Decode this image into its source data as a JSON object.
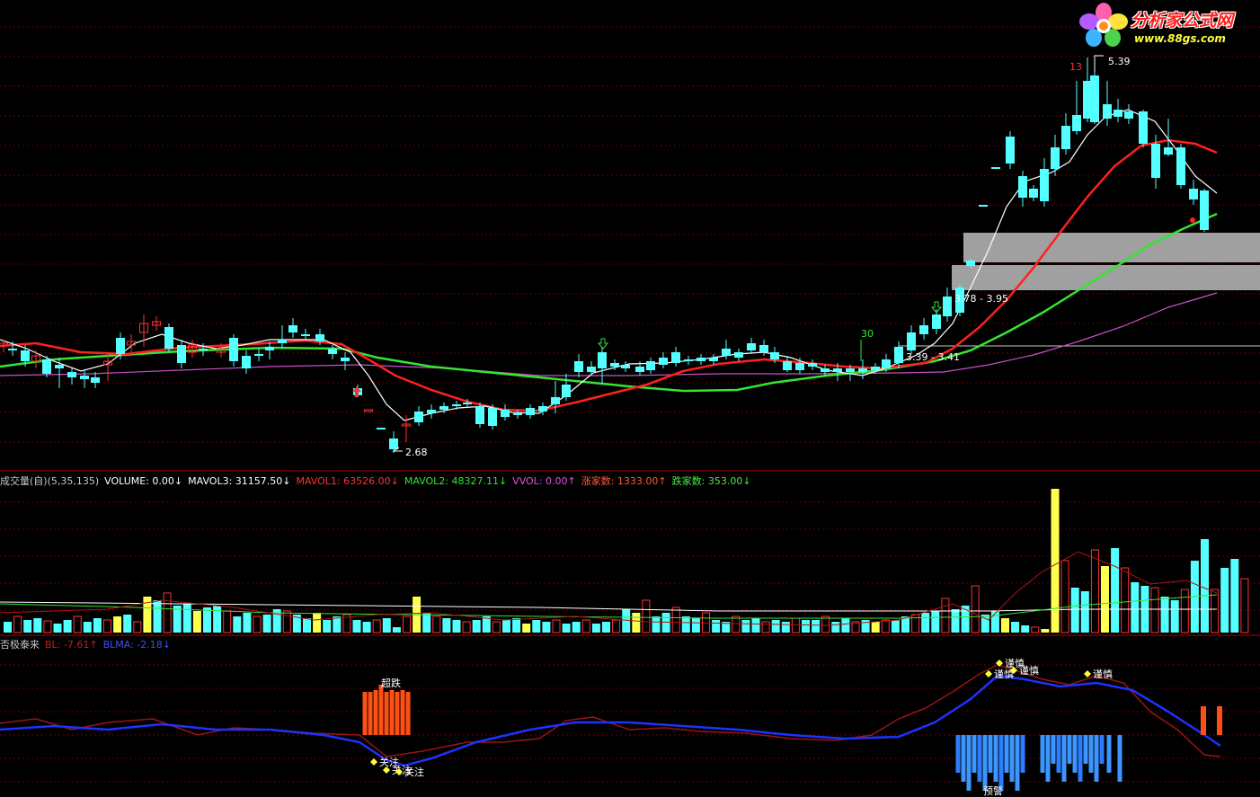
{
  "logo": {
    "title": "分析家公式网",
    "url_text": "www.88gs.com",
    "icon": "flower-logo-icon"
  },
  "colors": {
    "background": "#000000",
    "grid": "#6e0000",
    "panel_border": "#b40000",
    "candle_up": "#ff3232",
    "candle_down": "#54ffff",
    "ma_white": "#ffffff",
    "ma_red": "#ff2020",
    "ma_green": "#32e632",
    "ma_purple": "#c850c8",
    "volume_highlight": "#ffff50",
    "indicator_dark": "#9b1414",
    "indicator_blue": "#1e32ff",
    "alert_orange": "#ff5014",
    "alert_blue": "#3c96ff",
    "label_yellow": "#ffff32"
  },
  "price_panel": {
    "annotations": [
      {
        "text": "5.39",
        "role": "high-price"
      },
      {
        "text": "13",
        "role": "count-red"
      },
      {
        "text": "30",
        "role": "count-green"
      },
      {
        "text": "2.68",
        "role": "low-price"
      },
      {
        "text": "3.78 - 3.95",
        "role": "range-upper"
      },
      {
        "text": "3.39 - 3.41",
        "role": "range-lower"
      }
    ],
    "arrow_icons": [
      "up-arrow-icon",
      "down-arrow-icon"
    ]
  },
  "volume_panel": {
    "header": [
      {
        "text": "成交量(自)(5,35,135)",
        "color": "#c8c8c8"
      },
      {
        "text": "VOLUME: 0.00↓",
        "color": "#ffffff"
      },
      {
        "text": "MAVOL3: 31157.50↓",
        "color": "#ffffff"
      },
      {
        "text": "MAVOL1: 63526.00↓",
        "color": "#ff3232"
      },
      {
        "text": "MAVOL2: 48327.11↓",
        "color": "#32e632"
      },
      {
        "text": "VVOL: 0.00↑",
        "color": "#e650e6"
      },
      {
        "text": "涨家数: 1333.00↑",
        "color": "#ff5a3c"
      },
      {
        "text": "跌家数: 353.00↓",
        "color": "#50e650"
      }
    ]
  },
  "indicator_panel": {
    "header": [
      {
        "text": "否极泰来",
        "color": "#c8c8c8"
      },
      {
        "text": "BL: -7.61↑",
        "color": "#c81e1e"
      },
      {
        "text": "BLMA: -2.18↓",
        "color": "#3c50ff"
      }
    ],
    "signals": [
      {
        "text": "超跌",
        "role": "oversold"
      },
      {
        "text": "关注",
        "role": "watch"
      },
      {
        "text": "谨慎",
        "role": "caution"
      },
      {
        "text": "预警",
        "role": "warning"
      }
    ]
  }
}
